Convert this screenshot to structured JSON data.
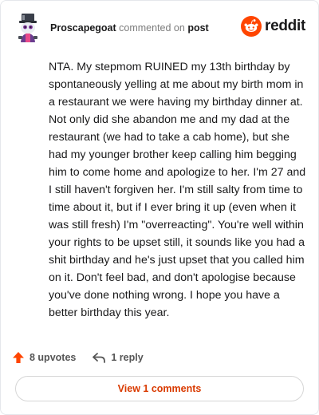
{
  "header": {
    "username": "Proscapegoat",
    "action_text": "commented on",
    "target_link": "post",
    "brand_name": "reddit"
  },
  "comment": {
    "body": "NTA. My stepmom RUINED my 13th birthday by spontaneously yelling at me about my birth mom in a restaurant we were having my birthday dinner at. Not only did she abandon me and my dad at the restaurant (we had to take a cab home), but she had my younger brother keep calling him begging him to come home and apologize to her. I'm 27 and I still haven't forgiven her. I'm still salty from time to time about it, but if I ever bring it up (even when it was still fresh) I'm \"overreacting\". You're well within your rights to be upset still, it sounds like you had a shit birthday and he's just upset that you called him on it. Don't feel bad, and don't apologise because you've done nothing wrong. I hope you have a better birthday this year."
  },
  "actions": {
    "upvotes_label": "8 upvotes",
    "reply_label": "1 reply"
  },
  "footer": {
    "view_comments_label": "View 1 comments"
  },
  "colors": {
    "accent": "#d93a00",
    "reddit_orange": "#ff4500",
    "upvote": "#ff4500"
  },
  "icons": {
    "upvote": "upvote-arrow-icon",
    "reply": "reply-arrow-icon",
    "brand": "reddit-logo-icon",
    "avatar": "snoo-avatar-icon"
  }
}
